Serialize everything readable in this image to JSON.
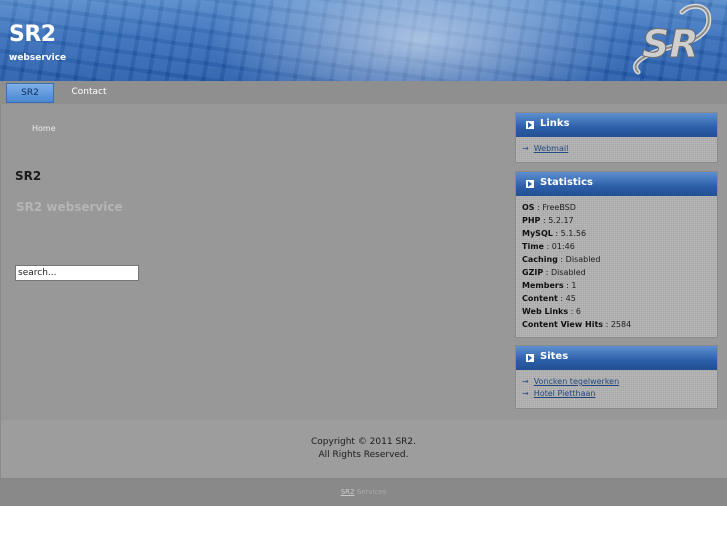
{
  "header": {
    "title": "SR2",
    "slogan": "webservice",
    "logo_text": "SR"
  },
  "nav": {
    "items": [
      {
        "label": "SR2",
        "active": true
      },
      {
        "label": "Contact",
        "active": false
      }
    ]
  },
  "main": {
    "breadcrumb": "Home",
    "heading": "SR2",
    "subheading": "SR2 webservice",
    "search": {
      "value": "search..."
    }
  },
  "sidebar": {
    "links": {
      "title": "Links",
      "items": [
        "Webmail"
      ]
    },
    "statistics": {
      "title": "Statistics",
      "rows": [
        {
          "label": "OS",
          "value": "FreeBSD"
        },
        {
          "label": "PHP",
          "value": "5.2.17"
        },
        {
          "label": "MySQL",
          "value": "5.1.56"
        },
        {
          "label": "Time",
          "value": "01:46"
        },
        {
          "label": "Caching",
          "value": "Disabled"
        },
        {
          "label": "GZIP",
          "value": "Disabled"
        },
        {
          "label": "Members",
          "value": "1"
        },
        {
          "label": "Content",
          "value": "45"
        },
        {
          "label": "Web Links",
          "value": "6"
        },
        {
          "label": "Content View Hits",
          "value": "2584"
        }
      ]
    },
    "sites": {
      "title": "Sites",
      "items": [
        "Voncken tegelwerken",
        "Hotel Pietthaan"
      ]
    }
  },
  "footer": {
    "copyright_line1": "Copyright © 2011 SR2.",
    "copyright_line2": "All Rights Reserved.",
    "credit_link": "SR2",
    "credit_text": "Services"
  },
  "colors": {
    "header_blue": "#2f69b8",
    "active_tab": "#4a86d0",
    "page_grey": "#989898",
    "link_blue": "#24497f"
  }
}
